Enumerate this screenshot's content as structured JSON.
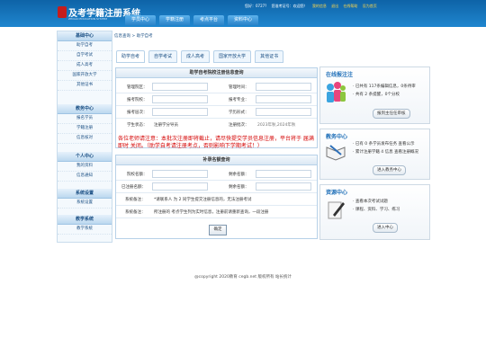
{
  "header": {
    "logo_title": "及考学籍注册系统",
    "logo_sub": "ZHIKAO EDUCATION SYSTEM",
    "info": [
      "您好：0727?",
      "您准考证号：欢迎您！",
      "我的信息",
      "退出",
      "在线帮助",
      "设为首页"
    ],
    "nav": [
      "学员中心",
      "学籍注册",
      "考点平台",
      "资料中心"
    ]
  },
  "sidebar": [
    {
      "title": "基础中心",
      "items": [
        "助学自考",
        "自学考试",
        "成人高考",
        "国家开放大学",
        "其他证书"
      ]
    },
    {
      "title": "教务中心",
      "items": [
        "报名学员",
        "学籍注册",
        "信息核对"
      ]
    },
    {
      "title": "个人中心",
      "items": [
        "我的资料",
        "信息通知"
      ]
    },
    {
      "title": "系统设置",
      "items": [
        "系统设置"
      ]
    },
    {
      "title": "教学系统",
      "items": [
        "教学系统"
      ]
    }
  ],
  "breadcrumb": "信息查询 > 助学自考",
  "tabs": [
    "助学自考",
    "自学考试",
    "成人高考",
    "国家开放大学",
    "其他证书"
  ],
  "registration": {
    "title": "助学自考院校注册信息查询",
    "labels": [
      "管理院区：",
      "管理时间：",
      "报考院校：",
      "报考专业：",
      "报考层次：",
      "学历形式：",
      "学生状态：",
      "注册批次："
    ],
    "values": {
      "status": "注册学分导员",
      "batch": "2023年秋,2024年秋"
    }
  },
  "notice": "各位老师请注意：本批次注册即将截止，请尽快提交学员信息注册，平台将于 届满即时 关闭。（助学自考请注册考点，否则影响下学期考试！）",
  "scores": {
    "title": "补录名额查询",
    "labels": [
      "院校名额：",
      "剩余名额：",
      "已注册名额：",
      "剩余名额：",
      "系统备注：",
      "系统备注："
    ],
    "remark1": "*请联系人 为 2 同学生提交注册信息的，无法注册考试",
    "remark2": "所注册的 考点学生列为实时信息，注册前请重新查询，一段注册",
    "ok": "确定"
  },
  "right_panels": [
    {
      "title": "在线报注注",
      "lines": [
        "· 已共有 117条编辑信息，0条待审",
        "· 共有 2 条提醒，0个分校"
      ],
      "button": "报到主任任审核"
    },
    {
      "title": "教务中心",
      "lines": [
        "· 已有 0 条学员发布任务 查看公示",
        "· 累计注册学籍 4 信息 查看注册概况"
      ],
      "button": "进入教务中心"
    },
    {
      "title": "资源中心",
      "lines": [
        "· 查看本次考试试题",
        "· 课程、资料、学习、练习"
      ],
      "button": "进入中心"
    }
  ],
  "footer": "@copyright 2020教育 cegb.net 版权所有 站长统计",
  "colors": {
    "header": "#0e63a7",
    "accent": "#1f6fb8",
    "warning": "#d40000"
  }
}
